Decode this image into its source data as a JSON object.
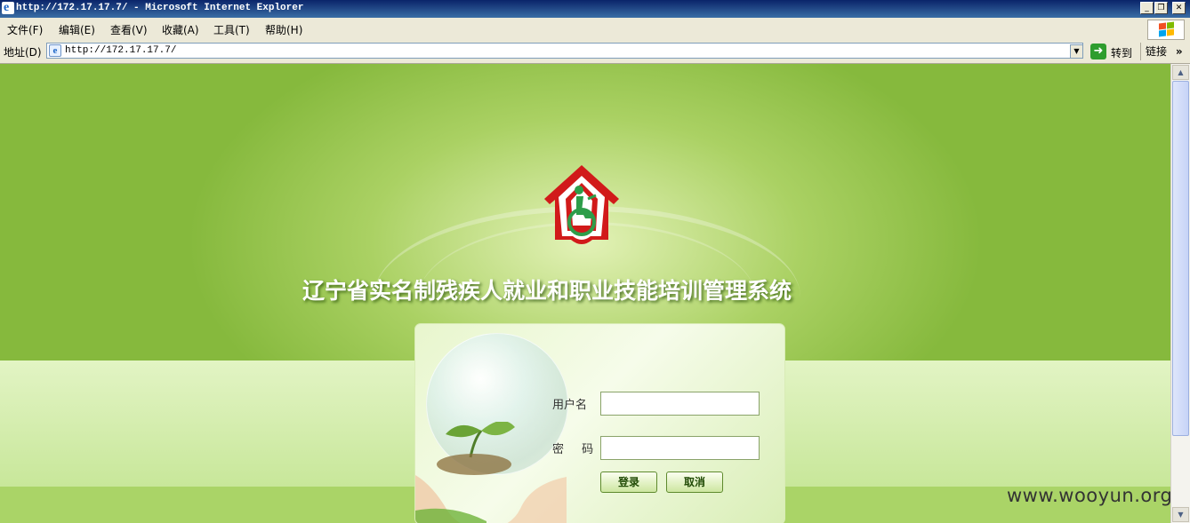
{
  "window": {
    "title": "http://172.17.17.7/ - Microsoft Internet Explorer",
    "icon": "ie-icon",
    "controls": [
      "minimize-icon",
      "restore-icon",
      "close-icon"
    ]
  },
  "menu": {
    "items": [
      {
        "label": "文件(F)"
      },
      {
        "label": "编辑(E)"
      },
      {
        "label": "查看(V)"
      },
      {
        "label": "收藏(A)"
      },
      {
        "label": "工具(T)"
      },
      {
        "label": "帮助(H)"
      }
    ]
  },
  "address": {
    "label": "地址(D)",
    "url": "http://172.17.17.7/",
    "go_label": "转到",
    "links_label": "链接",
    "more": "»"
  },
  "page": {
    "system_title": "辽宁省实名制残疾人就业和职业技能培训管理系统",
    "login": {
      "username_label": "用户名",
      "password_label": "密  码",
      "username_value": "",
      "password_value": "",
      "login_button": "登录",
      "cancel_button": "取消"
    },
    "watermark": "www.wooyun.org"
  },
  "colors": {
    "background_green": "#86b93d",
    "logo_red": "#d11a1a",
    "logo_green": "#2d9d4a"
  }
}
